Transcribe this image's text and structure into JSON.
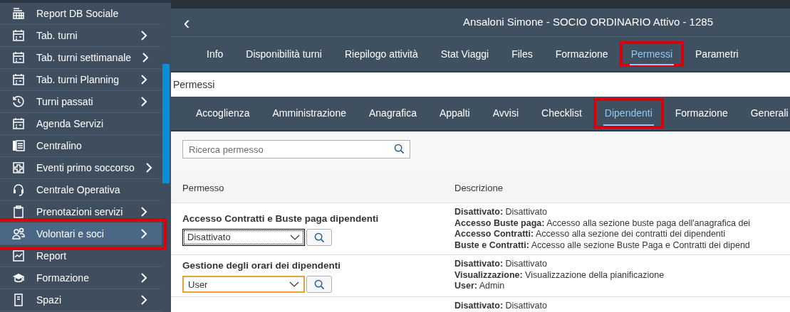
{
  "sidebar": {
    "items": [
      {
        "kind": "table",
        "label": "Report DB Sociale",
        "chevron": false,
        "selected": false,
        "highlighted": false
      },
      {
        "kind": "calendar",
        "label": "Tab. turni",
        "chevron": true,
        "selected": false,
        "highlighted": false
      },
      {
        "kind": "calendar",
        "label": "Tab. turni settimanale",
        "chevron": true,
        "selected": false,
        "highlighted": false
      },
      {
        "kind": "calendar",
        "label": "Tab. turni Planning",
        "chevron": true,
        "selected": false,
        "highlighted": false
      },
      {
        "kind": "history",
        "label": "Turni passati",
        "chevron": true,
        "selected": false,
        "highlighted": false
      },
      {
        "kind": "calendar",
        "label": "Agenda Servizi",
        "chevron": false,
        "selected": false,
        "highlighted": false
      },
      {
        "kind": "phone",
        "label": "Centralino",
        "chevron": false,
        "selected": false,
        "highlighted": false
      },
      {
        "kind": "firstaid",
        "label": "Eventi primo soccorso",
        "chevron": true,
        "selected": false,
        "highlighted": false
      },
      {
        "kind": "headset",
        "label": "Centrale Operativa",
        "chevron": false,
        "selected": false,
        "highlighted": false
      },
      {
        "kind": "clipboard",
        "label": "Prenotazioni servizi",
        "chevron": true,
        "selected": false,
        "highlighted": false
      },
      {
        "kind": "people",
        "label": "Volontari e soci",
        "chevron": true,
        "selected": true,
        "highlighted": true
      },
      {
        "kind": "chart",
        "label": "Report",
        "chevron": false,
        "selected": false,
        "highlighted": false
      },
      {
        "kind": "cap",
        "label": "Formazione",
        "chevron": true,
        "selected": false,
        "highlighted": false
      },
      {
        "kind": "doc",
        "label": "Spazi",
        "chevron": true,
        "selected": false,
        "highlighted": false
      }
    ]
  },
  "header": {
    "back": "‹",
    "title": "Ansaloni Simone - SOCIO ORDINARIO Attivo - 1285"
  },
  "tabs": [
    {
      "label": "Info",
      "selected": false,
      "highlighted": false
    },
    {
      "label": "Disponibilità turni",
      "selected": false,
      "highlighted": false
    },
    {
      "label": "Riepilogo attività",
      "selected": false,
      "highlighted": false
    },
    {
      "label": "Stat Viaggi",
      "selected": false,
      "highlighted": false
    },
    {
      "label": "Files",
      "selected": false,
      "highlighted": false
    },
    {
      "label": "Formazione",
      "selected": false,
      "highlighted": false
    },
    {
      "label": "Permessi",
      "selected": true,
      "highlighted": true
    },
    {
      "label": "Parametri",
      "selected": false,
      "highlighted": false
    }
  ],
  "section_title": "Permessi",
  "subtabs": [
    {
      "label": "Accoglienza",
      "selected": false,
      "highlighted": false
    },
    {
      "label": "Amministrazione",
      "selected": false,
      "highlighted": false
    },
    {
      "label": "Anagrafica",
      "selected": false,
      "highlighted": false
    },
    {
      "label": "Appalti",
      "selected": false,
      "highlighted": false
    },
    {
      "label": "Avvisi",
      "selected": false,
      "highlighted": false
    },
    {
      "label": "Checklist",
      "selected": false,
      "highlighted": false
    },
    {
      "label": "Dipendenti",
      "selected": true,
      "highlighted": true
    },
    {
      "label": "Formazione",
      "selected": false,
      "highlighted": false
    },
    {
      "label": "Generali",
      "selected": false,
      "highlighted": false
    }
  ],
  "search": {
    "placeholder": "Ricerca permesso"
  },
  "table": {
    "columns": [
      "Permesso",
      "Descrizione"
    ],
    "rows": [
      {
        "name": "Accesso Contratti e Buste paga dipendenti",
        "value": "Disattivato",
        "focused": true,
        "hovered": false,
        "description": [
          "**Disattivato:** Disattivato",
          "**Accesso Buste paga:** Accesso alla sezione buste paga dell'anagrafica dei",
          "**Accesso Contratti:** Accesso alla sezione dei contratti dei dipendenti",
          "**Buste e Contratti:** Accesso alle sezione Buste Paga e Contratti dei dipend"
        ]
      },
      {
        "name": "Gestione degli orari dei dipendenti",
        "value": "User",
        "focused": false,
        "hovered": true,
        "description": [
          "**Disattivato:** Disattivato",
          "**Visualizzazione:** Visualizzazione della pianificazione",
          "**User:** Admin"
        ]
      },
      {
        "description": [
          "**Disattivato:** Disattivato"
        ]
      }
    ]
  }
}
